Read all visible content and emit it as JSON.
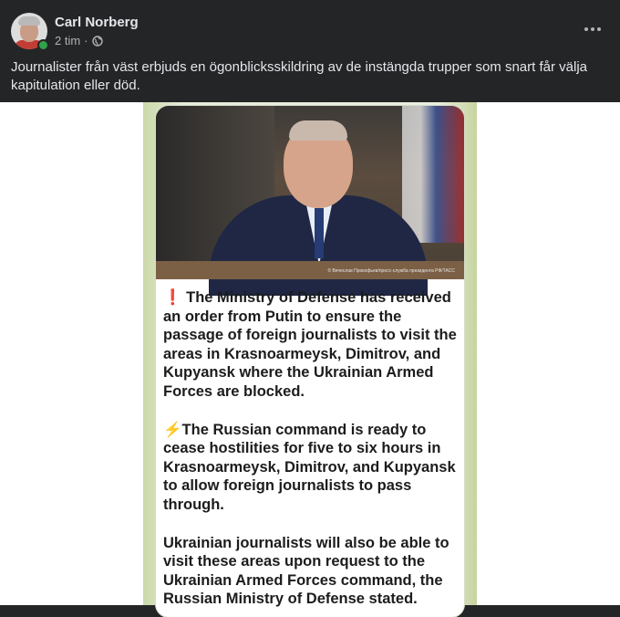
{
  "post": {
    "author": "Carl Norberg",
    "time": "2 tim",
    "separator": "·",
    "text": "Journalister från väst erbjuds en ögonblicksskildring av de instängda trupper som snart får välja kapitulation eller död."
  },
  "icons": {
    "globe": "globe-icon",
    "more": "more-options-icon"
  },
  "image": {
    "photo_caption": "© Вячеслав Прокофьев/пресс-служба президента РФ/ТАСС",
    "paragraph1_emoji": "❗",
    "paragraph1": "The Ministry of Defense has received an order from Putin to ensure the passage of foreign journalists to visit the areas in Krasnoarmeysk, Dimitrov, and Kupyansk where the Ukrainian Armed Forces are blocked.",
    "paragraph2_emoji": "⚡",
    "paragraph2": "The Russian command is ready to cease hostilities for five to six hours in Krasnoarmeysk, Dimitrov, and Kupyansk to allow foreign journalists to pass through.",
    "paragraph3": "Ukrainian journalists will also be able to visit these areas upon request to the Ukrainian Armed Forces command, the Russian Ministry of Defense stated."
  },
  "colors": {
    "background": "#242526",
    "text_primary": "#e4e6eb",
    "text_secondary": "#b0b3b8",
    "online": "#31a24c"
  }
}
